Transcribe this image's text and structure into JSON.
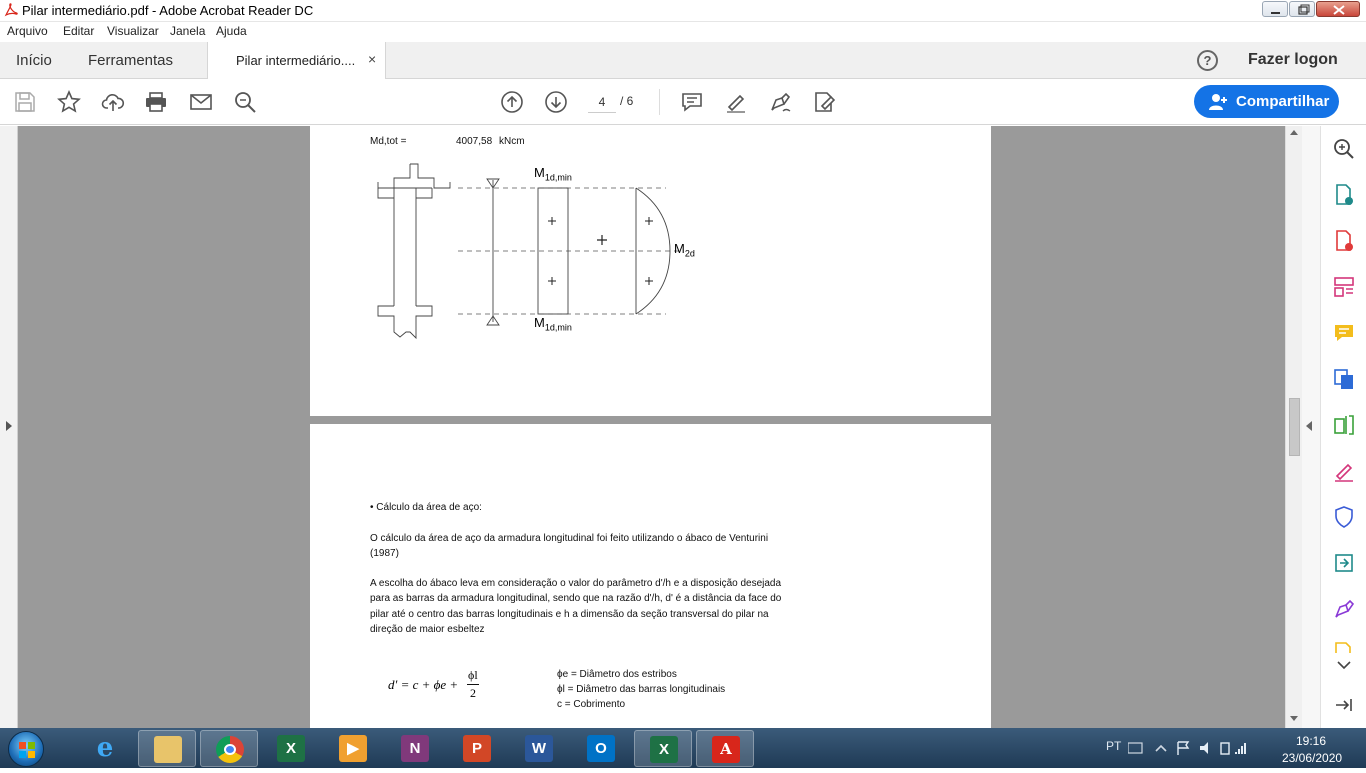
{
  "window": {
    "title": "Pilar intermediário.pdf - Adobe Acrobat Reader DC"
  },
  "menu": [
    "Arquivo",
    "Editar",
    "Visualizar",
    "Janela",
    "Ajuda"
  ],
  "tabs": {
    "home": "Início",
    "tools": "Ferramentas",
    "document": "Pilar intermediário....",
    "close": "×",
    "help": "?",
    "login": "Fazer logon"
  },
  "toolbar": {
    "page_current": "4",
    "page_total": "/ 6",
    "share_label": "Compartilhar",
    "share_color": "#1473e6"
  },
  "page1": {
    "md_label": "Md,tot =",
    "md_value": "4007,58",
    "md_unit": "kNcm",
    "diagram": {
      "m1d_top": "M",
      "m1d_top_sub": "1d,min",
      "m1d_bottom": "M",
      "m1d_bottom_sub": "1d,min",
      "m2d": "M",
      "m2d_sub": "2d",
      "plus": "+"
    }
  },
  "page2": {
    "bullet": "• Cálculo da área de aço:",
    "p1_line1": "O cálculo da área de aço da armadura longitudinal foi feito utilizando o ábaco de Venturini",
    "p1_line2": "(1987)",
    "p2_line1": "A escolha do ábaco leva em consideração o valor do parâmetro d'/h e a disposição desejada",
    "p2_line2": "para as barras da armadura longitudinal, sendo que na razão d'/h, d' é a distância da face do",
    "p2_line3": "pilar até o centro das barras longitudinais e h a dimensão da seção transversal do pilar na",
    "p2_line4": "direção de maior esbeltez",
    "formula_lhs": "d′ = c + ϕe +",
    "formula_num": "ϕl",
    "formula_den": "2",
    "legend": [
      "ϕe = Diâmetro dos estribos",
      "ϕl = Diâmetro das barras longitudinais",
      "c = Cobrimento"
    ]
  },
  "taskbar": {
    "apps": [
      "internet-explorer",
      "file-explorer",
      "chrome",
      "excel",
      "media-player",
      "onenote",
      "powerpoint",
      "word",
      "outlook",
      "excel",
      "acrobat"
    ],
    "lang": "PT",
    "time": "19:16",
    "date": "23/06/2020"
  }
}
